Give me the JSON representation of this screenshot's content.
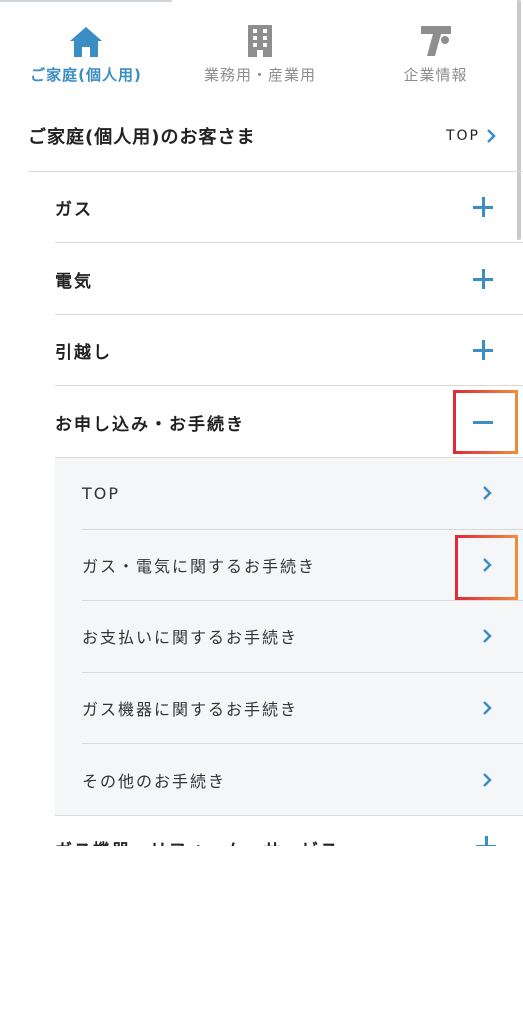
{
  "tabs": [
    {
      "label": "ご家庭(個人用)",
      "icon": "house-icon",
      "active": true
    },
    {
      "label": "業務用・産業用",
      "icon": "building-icon",
      "active": false
    },
    {
      "label": "企業情報",
      "icon": "corporate-logo-icon",
      "active": false
    }
  ],
  "section": {
    "title": "ご家庭(個人用)のお客さま",
    "top_link": "TOP"
  },
  "menu": [
    {
      "label": "ガス",
      "state": "collapsed"
    },
    {
      "label": "電気",
      "state": "collapsed"
    },
    {
      "label": "引越し",
      "state": "collapsed"
    },
    {
      "label": "お申し込み・お手続き",
      "state": "expanded"
    }
  ],
  "submenu": [
    {
      "label": "TOP"
    },
    {
      "label": "ガス・電気に関するお手続き"
    },
    {
      "label": "お支払いに関するお手続き"
    },
    {
      "label": "ガス機器に関するお手続き"
    },
    {
      "label": "その他のお手続き"
    }
  ],
  "partial_item": {
    "label": "ガス機器・リフォーム・サービス"
  },
  "colors": {
    "accent": "#3a8ec4",
    "highlight_start": "#e02a3a",
    "highlight_end": "#f08a3c"
  }
}
